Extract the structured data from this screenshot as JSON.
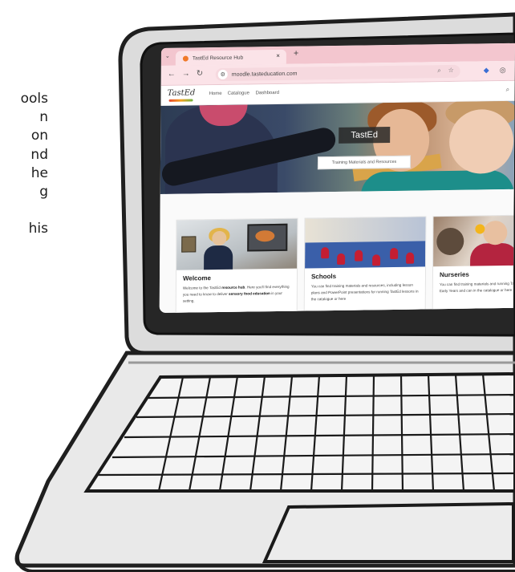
{
  "intro_text_lines": [
    "ools",
    "n",
    "on",
    "nd",
    "he",
    "g",
    "",
    "his"
  ],
  "browser": {
    "tab_title": "TastEd Resource Hub",
    "tab_close": "×",
    "new_tab": "+",
    "url": "moodle.tasteducation.com"
  },
  "site": {
    "logo_text": "TastEd",
    "nav": [
      "Home",
      "Catalogue",
      "Dashboard"
    ],
    "hero_title": "TastEd",
    "hero_button": "Training Materials and Resources",
    "cards": [
      {
        "title": "Welcome",
        "text_parts": [
          "Welcome to the TastEd ",
          "resource hub",
          ". Here you'll find everything you need to know to deliver ",
          "sensory food education",
          " in your setting."
        ]
      },
      {
        "title": "Schools",
        "text": "You can find training materials and resources, including lesson plans and PowerPoint presentations for running TastEd lessons in the catalogue or here"
      },
      {
        "title": "Nurseries",
        "text": "You can find training materials and running TastEd activities in Early Years and can in the catalogue or here"
      }
    ]
  },
  "colors": {
    "tabbar": "#f3c6cf",
    "toolbar": "#fbe3e8",
    "laptop_body": "#e6e6e6",
    "outline": "#222222"
  }
}
